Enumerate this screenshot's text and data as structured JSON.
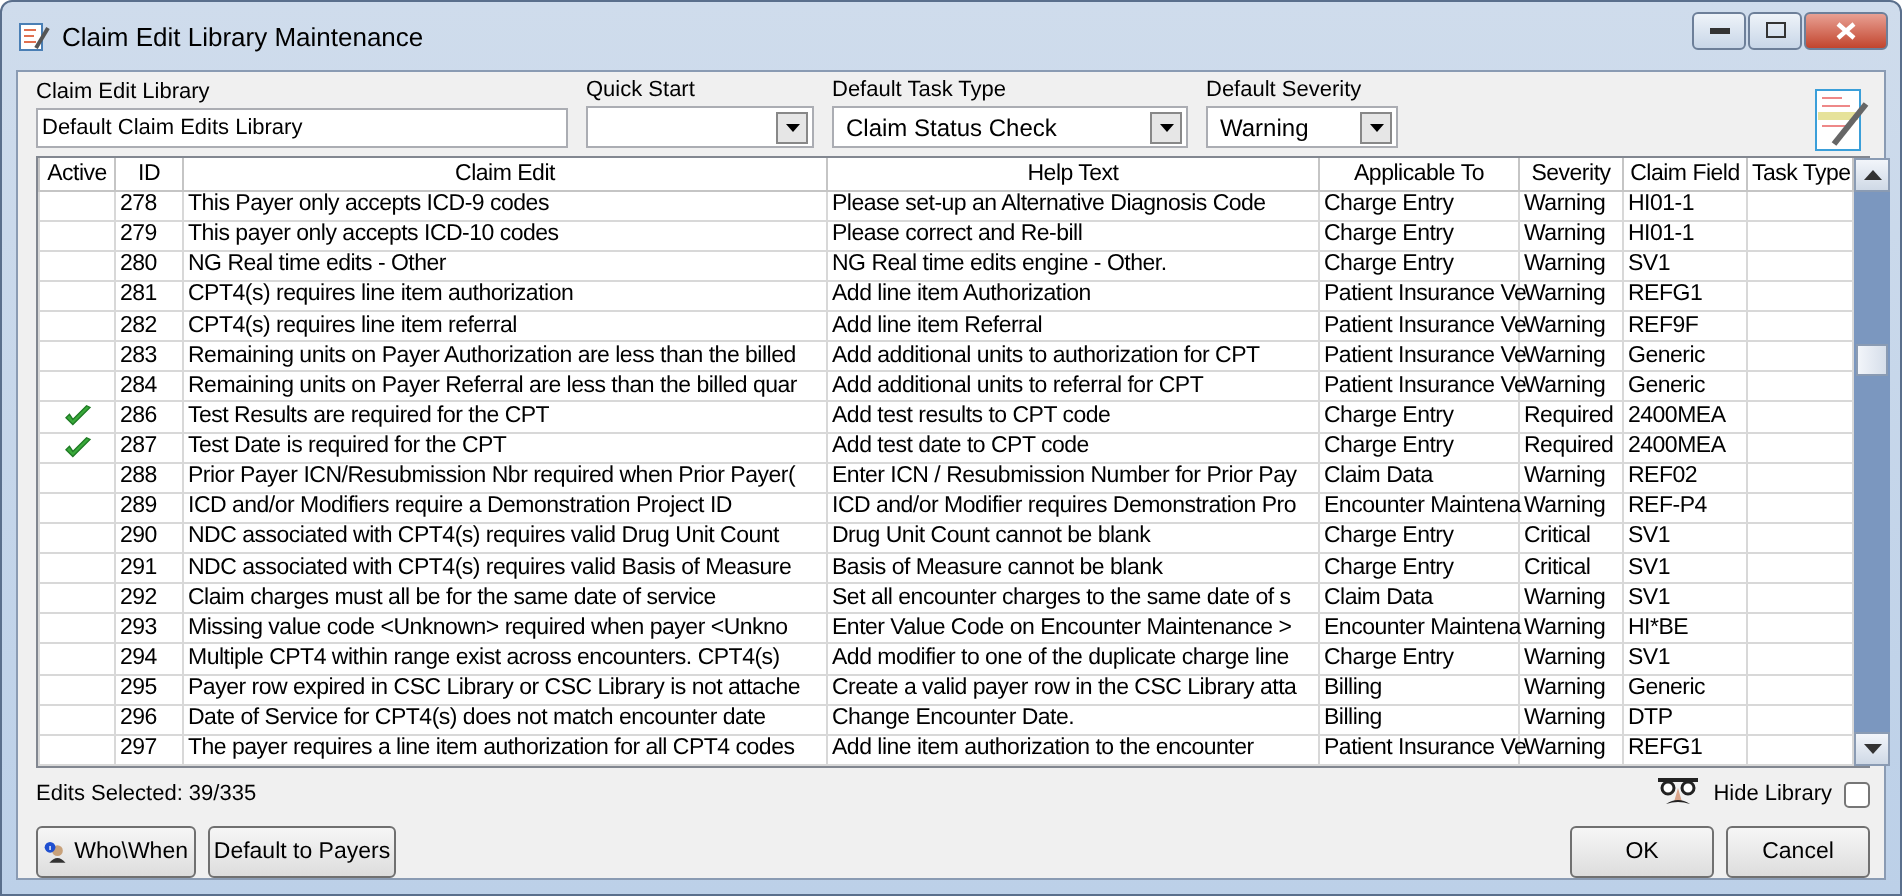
{
  "window": {
    "title": "Claim Edit Library Maintenance"
  },
  "fields": [
    {
      "label": "Claim Edit Library",
      "value": "Default Claim Edits Library",
      "kind": "text"
    },
    {
      "label": "Quick Start",
      "kind": "combo"
    },
    {
      "label": "Default Task Type",
      "value": "Claim Status Check",
      "kind": "combo"
    },
    {
      "label": "Default Severity",
      "value": "Warning",
      "kind": "combo"
    }
  ],
  "table": {
    "columns": [
      "Active",
      "ID",
      "Claim Edit",
      "Help Text",
      "Applicable To",
      "Severity",
      "Claim Field",
      "Task Type"
    ],
    "rows": [
      {
        "active": false,
        "id": "278",
        "claim_edit": "This Payer only accepts ICD-9 codes",
        "help_text": "Please set-up an Alternative Diagnosis Code",
        "applicable_to": "Charge Entry",
        "severity": "Warning",
        "claim_field": "HI01-1"
      },
      {
        "active": false,
        "id": "279",
        "claim_edit": "This payer only accepts ICD-10 codes",
        "help_text": "Please correct and Re-bill",
        "applicable_to": "Charge Entry",
        "severity": "Warning",
        "claim_field": "HI01-1"
      },
      {
        "active": false,
        "id": "280",
        "claim_edit": "NG Real time edits - Other",
        "help_text": "NG Real time edits engine - Other.",
        "applicable_to": "Charge Entry",
        "severity": "Warning",
        "claim_field": "SV1"
      },
      {
        "active": false,
        "id": "281",
        "claim_edit": "CPT4(s) requires line item authorization",
        "help_text": "Add line item Authorization",
        "applicable_to": "Patient Insurance Ve",
        "severity": "Warning",
        "claim_field": "REFG1"
      },
      {
        "active": false,
        "id": "282",
        "claim_edit": "CPT4(s) requires line item referral",
        "help_text": "Add line item Referral",
        "applicable_to": "Patient Insurance Ve",
        "severity": "Warning",
        "claim_field": "REF9F"
      },
      {
        "active": false,
        "id": "283",
        "claim_edit": "Remaining units on Payer Authorization are less than the billed",
        "help_text": "Add additional units to authorization for CPT",
        "applicable_to": "Patient Insurance Ve",
        "severity": "Warning",
        "claim_field": "Generic"
      },
      {
        "active": false,
        "id": "284",
        "claim_edit": "Remaining units on Payer Referral are less than the billed quar",
        "help_text": "Add additional units to referral for CPT",
        "applicable_to": "Patient Insurance Ve",
        "severity": "Warning",
        "claim_field": "Generic"
      },
      {
        "active": true,
        "id": "286",
        "claim_edit": "Test Results are required for the CPT",
        "help_text": "Add test results to CPT code",
        "applicable_to": "Charge Entry",
        "severity": "Required",
        "claim_field": "2400MEA"
      },
      {
        "active": true,
        "id": "287",
        "claim_edit": "Test Date is required for the CPT",
        "help_text": "Add test date to CPT code",
        "applicable_to": "Charge Entry",
        "severity": "Required",
        "claim_field": "2400MEA"
      },
      {
        "active": false,
        "id": "288",
        "claim_edit": "Prior Payer ICN/Resubmission Nbr required when Prior Payer(",
        "help_text": "Enter ICN / Resubmission Number for Prior Pay",
        "applicable_to": "Claim Data",
        "severity": "Warning",
        "claim_field": "REF02"
      },
      {
        "active": false,
        "id": "289",
        "claim_edit": "ICD and/or Modifiers require a Demonstration Project ID",
        "help_text": "ICD and/or Modifier requires Demonstration Pro",
        "applicable_to": "Encounter Maintena",
        "severity": "Warning",
        "claim_field": "REF-P4"
      },
      {
        "active": false,
        "id": "290",
        "claim_edit": "NDC associated with CPT4(s) requires valid Drug Unit Count",
        "help_text": "Drug Unit Count cannot be blank",
        "applicable_to": "Charge Entry",
        "severity": "Critical",
        "claim_field": "SV1"
      },
      {
        "active": false,
        "id": "291",
        "claim_edit": "NDC associated with CPT4(s) requires valid Basis of Measure",
        "help_text": "Basis of Measure cannot be blank",
        "applicable_to": "Charge Entry",
        "severity": "Critical",
        "claim_field": "SV1"
      },
      {
        "active": false,
        "id": "292",
        "claim_edit": "Claim charges must all be for the same date of service",
        "help_text": "Set all encounter charges to the same date of s",
        "applicable_to": "Claim Data",
        "severity": "Warning",
        "claim_field": "SV1"
      },
      {
        "active": false,
        "id": "293",
        "claim_edit": "Missing value code <Unknown> required when payer <Unkno",
        "help_text": "Enter Value Code on Encounter Maintenance >",
        "applicable_to": "Encounter Maintena",
        "severity": "Warning",
        "claim_field": "HI*BE"
      },
      {
        "active": false,
        "id": "294",
        "claim_edit": "Multiple CPT4 within range exist across encounters. CPT4(s)",
        "help_text": "Add modifier to one of the duplicate charge line",
        "applicable_to": "Charge Entry",
        "severity": "Warning",
        "claim_field": "SV1"
      },
      {
        "active": false,
        "id": "295",
        "claim_edit": "Payer row expired in CSC Library or CSC Library is not attache",
        "help_text": "Create a valid payer row in the CSC Library atta",
        "applicable_to": "Billing",
        "severity": "Warning",
        "claim_field": "Generic"
      },
      {
        "active": false,
        "id": "296",
        "claim_edit": "Date of Service for CPT4(s) does not match encounter date",
        "help_text": "Change Encounter Date.",
        "applicable_to": "Billing",
        "severity": "Warning",
        "claim_field": "DTP"
      },
      {
        "active": false,
        "id": "297",
        "claim_edit": "The payer requires a line item authorization for all CPT4 codes",
        "help_text": "Add line item authorization to the encounter",
        "applicable_to": "Patient Insurance Ve",
        "severity": "Warning",
        "claim_field": "REFG1"
      }
    ]
  },
  "status": "Edits Selected: 39/335",
  "hide_library": {
    "label": "Hide Library",
    "checked": false
  },
  "buttons": [
    {
      "label": "Who\\When",
      "kind": "icon"
    },
    {
      "label": "Default to Payers",
      "kind": "plain"
    },
    {
      "label": "OK",
      "kind": "plain"
    },
    {
      "label": "Cancel",
      "kind": "plain"
    }
  ]
}
